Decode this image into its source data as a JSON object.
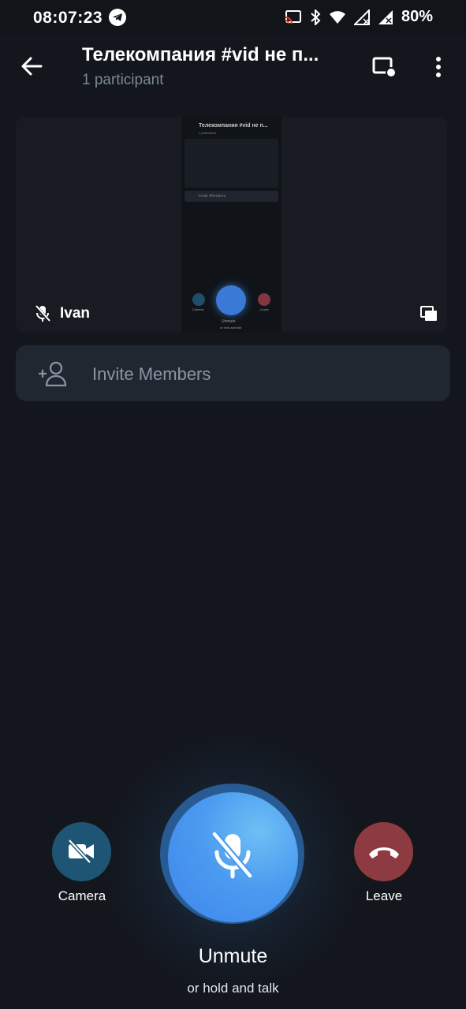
{
  "status_bar": {
    "time": "08:07:23",
    "battery": "80%",
    "icons": [
      "telegram-icon",
      "cast-icon",
      "bluetooth-icon",
      "wifi-icon",
      "signal-icon",
      "battery-icon"
    ]
  },
  "header": {
    "title": "Телекомпания #vid не п...",
    "subtitle": "1 participant"
  },
  "video_tile": {
    "participant_name": "Ivan",
    "thumbnail": {
      "title": "Телекомпания #vid не п...",
      "subtitle": "1 participant",
      "invite": "Invite Members",
      "camera": "Camera",
      "leave": "Leave",
      "unmute": "Unmute",
      "hold": "or hold and talk"
    }
  },
  "invite": {
    "label": "Invite Members"
  },
  "controls": {
    "camera_label": "Camera",
    "leave_label": "Leave",
    "unmute_label": "Unmute",
    "hold_hint": "or hold and talk"
  },
  "colors": {
    "background": "#13171d",
    "camera": "#1e5574",
    "leave": "#8d3a40",
    "mic": "#4a9bf0",
    "invite_bg": "#212731"
  }
}
